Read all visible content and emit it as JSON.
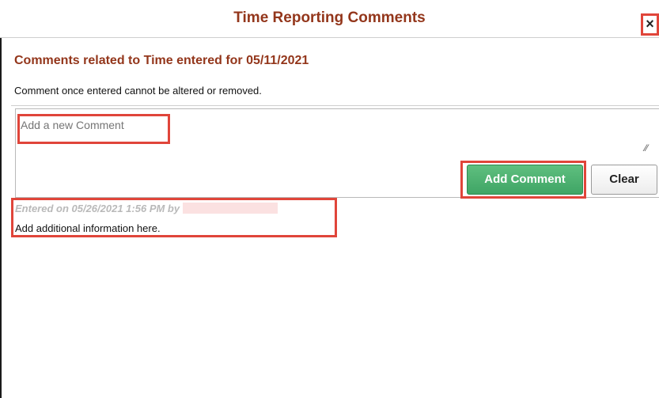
{
  "window": {
    "title": "Time Reporting Comments",
    "close_label": "×"
  },
  "header": {
    "heading": "Comments related to Time entered for 05/11/2021",
    "notice": "Comment once entered cannot be altered or removed."
  },
  "comment_form": {
    "placeholder": "Add a new Comment",
    "value": "",
    "add_label": "Add Comment",
    "clear_label": "Clear"
  },
  "comments": [
    {
      "meta": "Entered on 05/26/2021 1:56 PM by",
      "author_redacted": true,
      "text": "Add additional information here."
    }
  ],
  "colors": {
    "title": "#93361b",
    "highlight": "#e0453a",
    "primary_button": "#4cb070",
    "meta_text": "#b9b9b9"
  },
  "icons": {
    "close": "close-icon",
    "resize": "resize-grip-icon"
  }
}
